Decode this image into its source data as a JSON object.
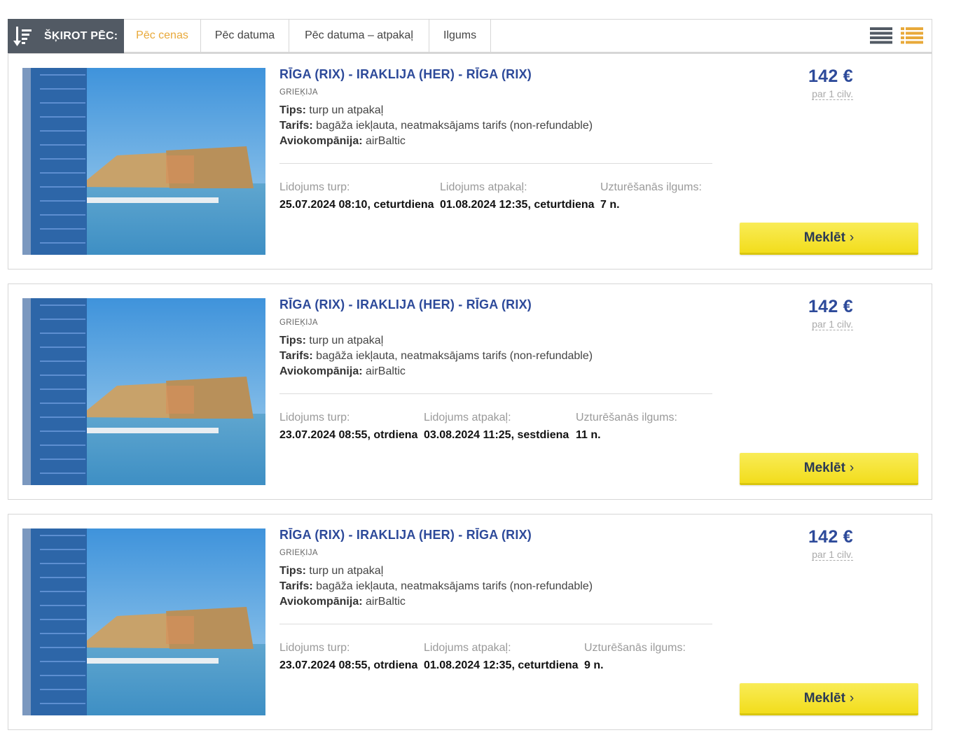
{
  "sort": {
    "label": "ŠĶIROT PĒC:",
    "tabs": [
      {
        "label": "Pēc cenas",
        "active": true
      },
      {
        "label": "Pēc datuma",
        "active": false
      },
      {
        "label": "Pēc datuma – atpakaļ",
        "active": false
      },
      {
        "label": "Ilgums",
        "active": false
      }
    ],
    "view_icons": [
      "list-view-icon",
      "detailed-list-view-icon"
    ]
  },
  "colors": {
    "accent_orange": "#e8a93a",
    "title_blue": "#2d4a9a",
    "button_yellow": "#f5e33a",
    "sort_label_bg": "#525a64"
  },
  "cards": [
    {
      "route": "RĪGA (RIX) - IRAKLIJA (HER) - RĪGA (RIX)",
      "country": "GRIEĶIJA",
      "type_label": "Tips:",
      "type_value": "turp un atpakaļ",
      "fare_label": "Tarifs:",
      "fare_value": "bagāža iekļauta, neatmaksājams tarifs (non-refundable)",
      "airline_label": "Aviokompānija:",
      "airline_value": "airBaltic",
      "out_label": "Lidojums turp:",
      "out_value": "25.07.2024 08:10, ceturtdiena",
      "back_label": "Lidojums atpakaļ:",
      "back_value": "01.08.2024 12:35, ceturtdiena",
      "stay_label": "Uzturēšanās ilgums:",
      "stay_value": "7 n.",
      "price": "142 €",
      "per": "par 1 cilv.",
      "button": "Meklēt"
    },
    {
      "route": "RĪGA (RIX) - IRAKLIJA (HER) - RĪGA (RIX)",
      "country": "GRIEĶIJA",
      "type_label": "Tips:",
      "type_value": "turp un atpakaļ",
      "fare_label": "Tarifs:",
      "fare_value": "bagāža iekļauta, neatmaksājams tarifs (non-refundable)",
      "airline_label": "Aviokompānija:",
      "airline_value": "airBaltic",
      "out_label": "Lidojums turp:",
      "out_value": "23.07.2024 08:55, otrdiena",
      "back_label": "Lidojums atpakaļ:",
      "back_value": "03.08.2024 11:25, sestdiena",
      "stay_label": "Uzturēšanās ilgums:",
      "stay_value": "11 n.",
      "price": "142 €",
      "per": "par 1 cilv.",
      "button": "Meklēt"
    },
    {
      "route": "RĪGA (RIX) - IRAKLIJA (HER) - RĪGA (RIX)",
      "country": "GRIEĶIJA",
      "type_label": "Tips:",
      "type_value": "turp un atpakaļ",
      "fare_label": "Tarifs:",
      "fare_value": "bagāža iekļauta, neatmaksājams tarifs (non-refundable)",
      "airline_label": "Aviokompānija:",
      "airline_value": "airBaltic",
      "out_label": "Lidojums turp:",
      "out_value": "23.07.2024 08:55, otrdiena",
      "back_label": "Lidojums atpakaļ:",
      "back_value": "01.08.2024 12:35, ceturtdiena",
      "stay_label": "Uzturēšanās ilgums:",
      "stay_value": "9 n.",
      "price": "142 €",
      "per": "par 1 cilv.",
      "button": "Meklēt"
    }
  ]
}
